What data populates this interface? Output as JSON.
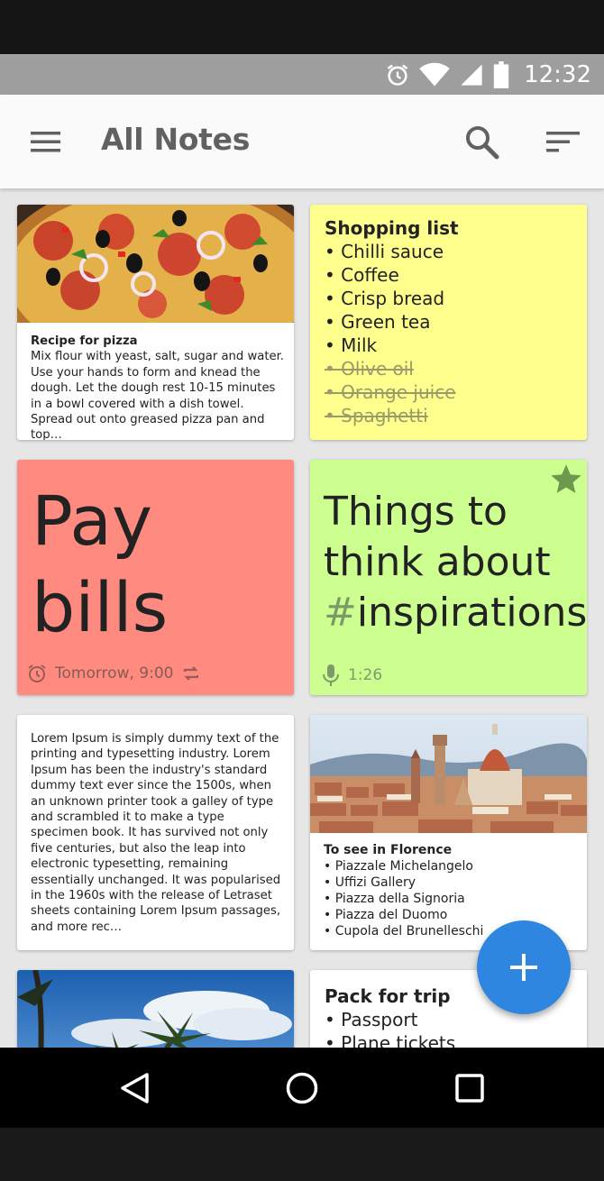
{
  "status_bar": {
    "time": "12:32",
    "icons": [
      "alarm-icon",
      "wifi-icon",
      "signal-icon",
      "battery-icon"
    ]
  },
  "app_bar": {
    "title": "All Notes",
    "icons": [
      "menu-icon",
      "search-icon",
      "sort-icon"
    ]
  },
  "notes": {
    "pizza": {
      "title": "Recipe for pizza",
      "body": "Mix flour with yeast, salt, sugar and water. Use your hands to form and knead the dough. Let the dough rest 10-15 minutes in a bowl covered with a dish towel. Spread out onto greased pizza pan and top…",
      "color": "#ffffff"
    },
    "shopping": {
      "title": "Shopping list",
      "items": [
        "• Chilli sauce",
        "• Coffee",
        "• Crisp bread",
        "• Green tea",
        "• Milk"
      ],
      "done_items": [
        "• Olive oil",
        "• Orange juice",
        "• Spaghetti"
      ],
      "color": "#ffff8d"
    },
    "bills": {
      "line1": "Pay",
      "line2": "bills",
      "reminder": "Tomorrow, 9:00",
      "color": "#ff8a80"
    },
    "inspire": {
      "line1": "Things to",
      "line2": "think about",
      "hash": "#",
      "tag": "inspirations",
      "duration": "1:26",
      "starred": true,
      "color": "#ccff90"
    },
    "lorem": {
      "body": "Lorem Ipsum is simply dummy text of the printing and typesetting industry. Lorem Ipsum has been the industry's standard dummy text ever since the 1500s, when an unknown printer took a galley of type and scrambled it to make a type specimen book. It has survived not only five centuries, but also the leap into electronic typesetting, remaining essentially unchanged. It was popularised in the 1960s with the release of Letraset sheets containing Lorem Ipsum passages, and more rec…",
      "color": "#ffffff"
    },
    "florence": {
      "title": "To see in Florence",
      "items": [
        "• Piazzale Michelangelo",
        "• Uffizi Gallery",
        "• Piazza della Signoria",
        "• Piazza del Duomo",
        "• Cupola del Brunelleschi"
      ],
      "color": "#ffffff"
    },
    "trip": {
      "title": "Pack for trip",
      "items": [
        "• Passport",
        "• Plane tickets"
      ],
      "color": "#ffffff"
    }
  },
  "fab": {
    "icon": "plus-icon"
  },
  "nav_bar": {
    "icons": [
      "back-icon",
      "home-icon",
      "recents-icon"
    ]
  },
  "colors": {
    "accent": "#2e86e0",
    "appbar": "#fafafa",
    "statusbar": "#9e9e9e"
  }
}
